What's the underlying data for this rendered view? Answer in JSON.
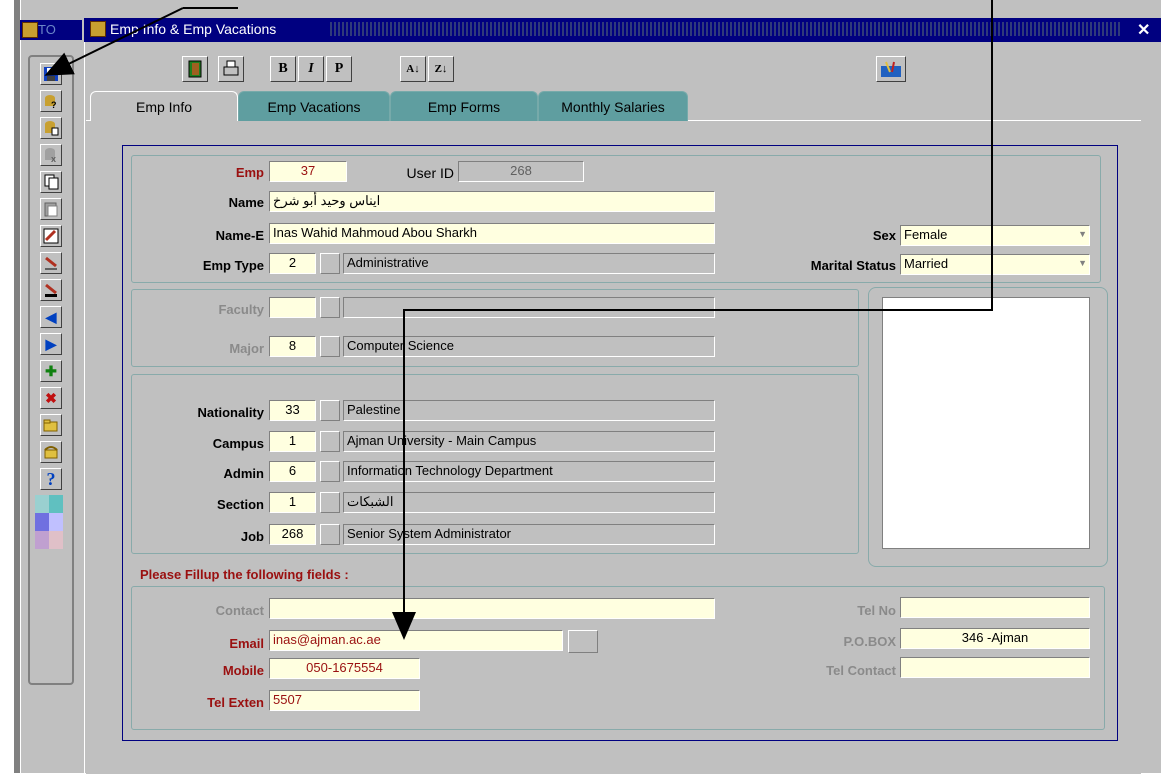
{
  "outer": {
    "title": "TO"
  },
  "window": {
    "title": "Emp Info & Emp Vacations",
    "close": "✕"
  },
  "toolbar_top": {
    "b": "B",
    "i": "I",
    "p": "P",
    "sort_az": "A↓Z",
    "sort_za": "Z↓A"
  },
  "tabs": [
    {
      "label": "Emp Info",
      "active": true
    },
    {
      "label": "Emp Vacations",
      "active": false
    },
    {
      "label": "Emp Forms",
      "active": false
    },
    {
      "label": "Monthly Salaries",
      "active": false
    }
  ],
  "employee": {
    "emp_label": "Emp",
    "emp_value": "37",
    "userid_label": "User ID",
    "userid_value": "268",
    "name_label": "Name",
    "name_value": "ايناس وحيد أبو شرخ",
    "name_e_label": "Name-E",
    "name_e_value": "Inas Wahid Mahmoud Abou Sharkh",
    "emptype_label": "Emp Type",
    "emptype_code": "2",
    "emptype_value": "Administrative",
    "sex_label": "Sex",
    "sex_value": "Female",
    "marital_label": "Marital Status",
    "marital_value": "Married"
  },
  "academic": {
    "faculty_label": "Faculty",
    "faculty_code": "",
    "faculty_value": "",
    "major_label": "Major",
    "major_code": "8",
    "major_value": "Computer Science"
  },
  "org": {
    "nationality_label": "Nationality",
    "nationality_code": "33",
    "nationality_value": "Palestine",
    "campus_label": "Campus",
    "campus_code": "1",
    "campus_value": "Ajman University - Main Campus",
    "admin_label": "Admin",
    "admin_code": "6",
    "admin_value": "Information Technology Department",
    "section_label": "Section",
    "section_code": "1",
    "section_value": "الشبكات",
    "job_label": "Job",
    "job_code": "268",
    "job_value": "Senior System Administrator"
  },
  "contact": {
    "header": "Please Fillup the following fields :",
    "contact_label": "Contact",
    "contact_value": "",
    "email_label": "Email",
    "email_value": "inas@ajman.ac.ae",
    "mobile_label": "Mobile",
    "mobile_value": "050-1675554",
    "telexten_label": "Tel Exten",
    "telexten_value": "5507",
    "telno_label": "Tel No",
    "telno_value": "",
    "pobox_label": "P.O.BOX",
    "pobox_value": "346 -Ajman",
    "telcontact_label": "Tel Contact",
    "telcontact_value": ""
  },
  "icons": {
    "save": "save-icon",
    "query": "query-icon",
    "exit": "exit-door-icon",
    "print": "print-icon",
    "help": "help-icon"
  },
  "colors": {
    "title_bar": "#000080",
    "field_bg": "#ffffe0",
    "label_red": "#9a1010",
    "tab_inactive": "#5f9ea0"
  }
}
